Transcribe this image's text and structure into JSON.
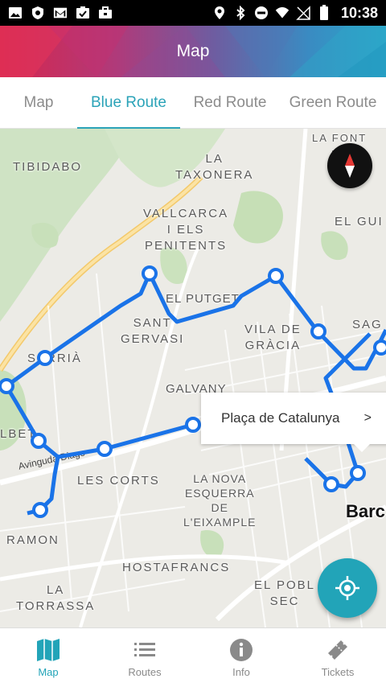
{
  "status_bar": {
    "time": "10:38",
    "left_icons": [
      "image-icon",
      "shield-icon",
      "gmail-icon",
      "task-check-icon",
      "briefcase-icon"
    ],
    "right_icons": [
      "location-icon",
      "bluetooth-icon",
      "do-not-disturb-icon",
      "wifi-icon",
      "signal-icon",
      "battery-icon"
    ]
  },
  "header": {
    "title": "Map"
  },
  "tabs": [
    {
      "label": "Map",
      "active": false
    },
    {
      "label": "Blue Route",
      "active": true
    },
    {
      "label": "Red Route",
      "active": false
    },
    {
      "label": "Green Route",
      "active": false
    }
  ],
  "map": {
    "labels": {
      "tibidabo": "TIBIDABO",
      "la_taxonera": "LA\nTAXONERA",
      "la_font": "LA FONT\nFA",
      "vallcarca": "VALLCARCA\nI ELS\nPENITENTS",
      "el_gui": "EL GUI",
      "el_putget": "EL PUTGET",
      "sant_gervasi": "SANT\nGERVASI",
      "vila_de_gracia": "VILA DE\nGRÀCIA",
      "sag": "SAG",
      "sarria": "SARRIÀ",
      "galvany": "GALVANY",
      "elbet": "LBET",
      "les_corts": "LES CORTS",
      "la_nova_esquerra": "LA NOVA\nESQUERRA\nDE\nL'EIXAMPLE",
      "barcelona": "Barc",
      "ramon": "RAMON",
      "hostafrancs": "HOSTAFRANCS",
      "la_torrassa": "LA\nTORRASSA",
      "el_poble_sec": "EL POBL\nSEC",
      "road_diagonal": "Avinguda Diago"
    },
    "route_color": "#1a73e8",
    "callout": {
      "text": "Plaça de Catalunya",
      "arrow": ">"
    },
    "compass_icon": "compass-icon",
    "locate_icon": "my-location-icon"
  },
  "bottom_nav": [
    {
      "label": "Map",
      "icon": "map-icon",
      "active": true
    },
    {
      "label": "Routes",
      "icon": "list-icon",
      "active": false
    },
    {
      "label": "Info",
      "icon": "info-icon",
      "active": false
    },
    {
      "label": "Tickets",
      "icon": "ticket-icon",
      "active": false
    }
  ],
  "colors": {
    "accent": "#22a4b8",
    "tab_active": "#2ba3b8"
  }
}
